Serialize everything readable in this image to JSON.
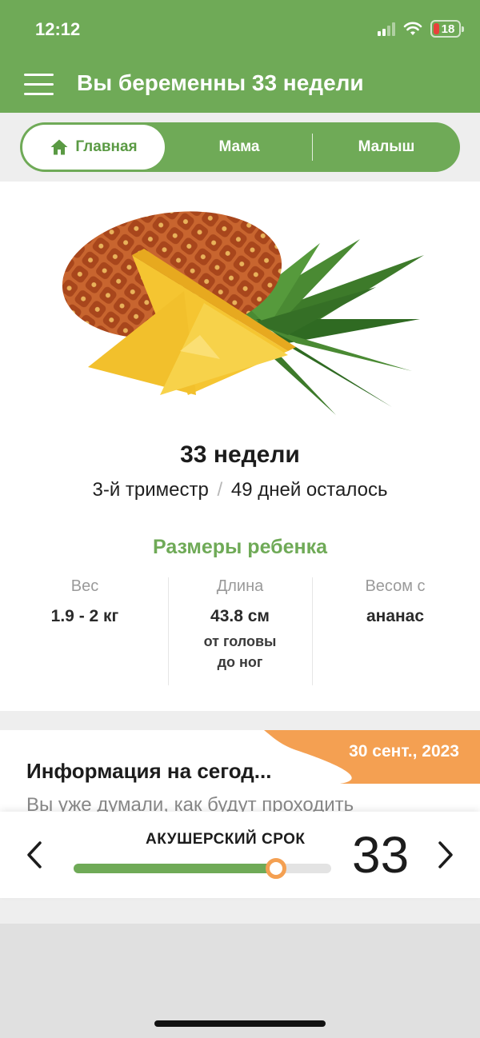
{
  "status_bar": {
    "time": "12:12",
    "battery_level": "18",
    "icons": [
      "signal-icon",
      "wifi-icon",
      "battery-icon"
    ]
  },
  "header": {
    "title": "Вы беременны 33 недели",
    "menu_icon": "menu-icon",
    "background_color": "#6faa57"
  },
  "tabs": {
    "items": [
      {
        "label": "Главная",
        "icon": "home-icon",
        "active": true
      },
      {
        "label": "Мама",
        "active": false
      },
      {
        "label": "Малыш",
        "active": false
      }
    ]
  },
  "main": {
    "fruit_image": "pineapple",
    "week_title": "33 недели",
    "trimester": "3-й триместр",
    "separator": "/",
    "days_left": "49 дней осталось",
    "sizes_heading": "Размеры ребенка",
    "stats": [
      {
        "label": "Вес",
        "value": "1.9 - 2 кг",
        "note": ""
      },
      {
        "label": "Длина",
        "value": "43.8 см",
        "note_line1": "от головы",
        "note_line2": "до ног"
      },
      {
        "label": "Весом с",
        "value": "ананас",
        "note": ""
      }
    ]
  },
  "info_card": {
    "date": "30 сент., 2023",
    "title": "Информация на сегод...",
    "body": "Вы уже думали, как будут проходить"
  },
  "term_slider": {
    "label": "АКУШЕРСКИЙ СРОК",
    "value": "33",
    "progress_fraction": 0.785,
    "prev_icon": "chevron-left-icon",
    "next_icon": "chevron-right-icon"
  },
  "colors": {
    "accent_green": "#6faa57",
    "accent_orange": "#f4a052",
    "muted_text": "#9a9a9a"
  }
}
